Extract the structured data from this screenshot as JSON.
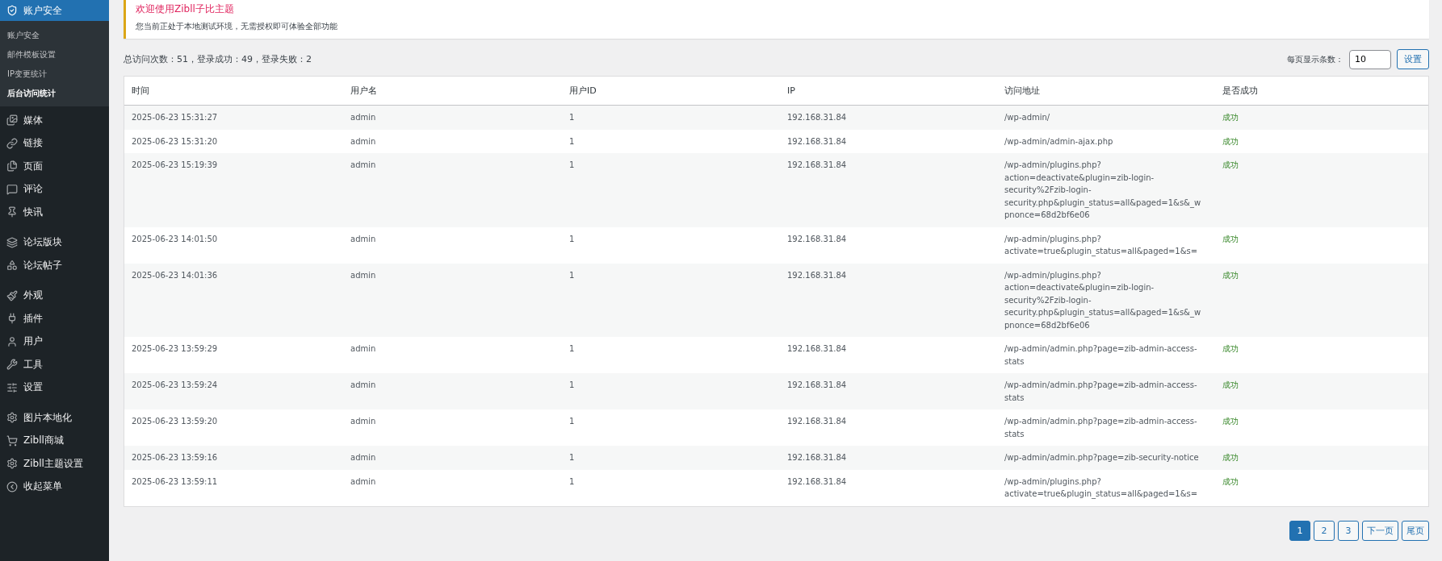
{
  "sidebar": {
    "current": {
      "label": "账户安全",
      "selected": true,
      "submenu": [
        {
          "label": "账户安全",
          "selected": false
        },
        {
          "label": "邮件模板设置",
          "selected": false
        },
        {
          "label": "IP变更统计",
          "selected": false
        },
        {
          "label": "后台访问统计",
          "selected": true
        }
      ]
    },
    "groups": [
      [
        {
          "label": "媒体",
          "selected": false
        },
        {
          "label": "链接",
          "selected": false
        },
        {
          "label": "页面",
          "selected": false
        },
        {
          "label": "评论",
          "selected": false
        },
        {
          "label": "快讯",
          "selected": false
        }
      ],
      [
        {
          "label": "论坛版块",
          "selected": false
        },
        {
          "label": "论坛帖子",
          "selected": false
        }
      ],
      [
        {
          "label": "外观",
          "selected": false
        },
        {
          "label": "插件",
          "selected": false
        },
        {
          "label": "用户",
          "selected": false
        },
        {
          "label": "工具",
          "selected": false
        },
        {
          "label": "设置",
          "selected": false
        }
      ],
      [
        {
          "label": "图片本地化",
          "selected": false
        },
        {
          "label": "Zibll商城",
          "selected": false
        },
        {
          "label": "Zibll主题设置",
          "selected": false
        },
        {
          "label": "收起菜单",
          "selected": false
        }
      ]
    ]
  },
  "notice": {
    "title": "欢迎使用Zibll子比主题",
    "text": "您当前正处于本地测试环境，无需授权即可体验全部功能"
  },
  "summary": "总访问次数：51，登录成功：49，登录失败：2",
  "per_page": {
    "label": "每页显示条数：",
    "value": "10",
    "button": "设置"
  },
  "table": {
    "columns": [
      "时间",
      "用户名",
      "用户ID",
      "IP",
      "访问地址",
      "是否成功"
    ],
    "rows": [
      {
        "time": "2025-06-23 15:31:27",
        "user": "admin",
        "user_id": "1",
        "ip": "192.168.31.84",
        "url": "/wp-admin/",
        "result": "成功"
      },
      {
        "time": "2025-06-23 15:31:20",
        "user": "admin",
        "user_id": "1",
        "ip": "192.168.31.84",
        "url": "/wp-admin/admin-ajax.php",
        "result": "成功"
      },
      {
        "time": "2025-06-23 15:19:39",
        "user": "admin",
        "user_id": "1",
        "ip": "192.168.31.84",
        "url": "/wp-admin/plugins.php?action=deactivate&plugin=zib-login-security%2Fzib-login-security.php&plugin_status=all&paged=1&s&_wpnonce=68d2bf6e06",
        "result": "成功"
      },
      {
        "time": "2025-06-23 14:01:50",
        "user": "admin",
        "user_id": "1",
        "ip": "192.168.31.84",
        "url": "/wp-admin/plugins.php?activate=true&plugin_status=all&paged=1&s=",
        "result": "成功"
      },
      {
        "time": "2025-06-23 14:01:36",
        "user": "admin",
        "user_id": "1",
        "ip": "192.168.31.84",
        "url": "/wp-admin/plugins.php?action=deactivate&plugin=zib-login-security%2Fzib-login-security.php&plugin_status=all&paged=1&s&_wpnonce=68d2bf6e06",
        "result": "成功"
      },
      {
        "time": "2025-06-23 13:59:29",
        "user": "admin",
        "user_id": "1",
        "ip": "192.168.31.84",
        "url": "/wp-admin/admin.php?page=zib-admin-access-stats",
        "result": "成功"
      },
      {
        "time": "2025-06-23 13:59:24",
        "user": "admin",
        "user_id": "1",
        "ip": "192.168.31.84",
        "url": "/wp-admin/admin.php?page=zib-admin-access-stats",
        "result": "成功"
      },
      {
        "time": "2025-06-23 13:59:20",
        "user": "admin",
        "user_id": "1",
        "ip": "192.168.31.84",
        "url": "/wp-admin/admin.php?page=zib-admin-access-stats",
        "result": "成功"
      },
      {
        "time": "2025-06-23 13:59:16",
        "user": "admin",
        "user_id": "1",
        "ip": "192.168.31.84",
        "url": "/wp-admin/admin.php?page=zib-security-notice",
        "result": "成功"
      },
      {
        "time": "2025-06-23 13:59:11",
        "user": "admin",
        "user_id": "1",
        "ip": "192.168.31.84",
        "url": "/wp-admin/plugins.php?activate=true&plugin_status=all&paged=1&s=",
        "result": "成功"
      }
    ]
  },
  "pagination": [
    {
      "label": "1",
      "selected": true
    },
    {
      "label": "2",
      "selected": false
    },
    {
      "label": "3",
      "selected": false
    },
    {
      "label": "下一页",
      "selected": false
    },
    {
      "label": "尾页",
      "selected": false
    }
  ]
}
